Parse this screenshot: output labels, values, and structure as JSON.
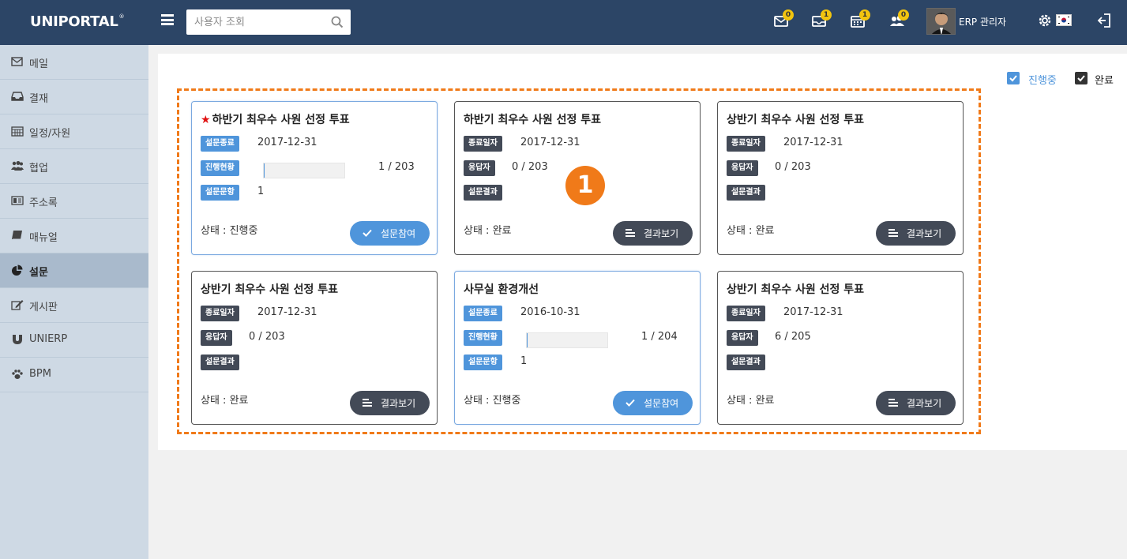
{
  "app": {
    "logo": "UNIPORTAL",
    "logo_mark": "®"
  },
  "search": {
    "placeholder": "사용자 조회"
  },
  "header": {
    "badges": {
      "mail": "0",
      "approval": "1",
      "schedule": "1",
      "collab": "0"
    },
    "user_name": "ERP 관리자"
  },
  "sidebar": {
    "items": [
      {
        "label": "메일",
        "icon": "mail-icon"
      },
      {
        "label": "결재",
        "icon": "inbox-icon"
      },
      {
        "label": "일정/자원",
        "icon": "calendar-icon"
      },
      {
        "label": "협업",
        "icon": "users-icon"
      },
      {
        "label": "주소록",
        "icon": "address-card-icon"
      },
      {
        "label": "매뉴얼",
        "icon": "book-icon"
      },
      {
        "label": "설문",
        "icon": "pie-chart-icon",
        "active": true
      },
      {
        "label": "게시판",
        "icon": "edit-icon"
      },
      {
        "label": "UNIERP",
        "icon": "magnet-icon"
      },
      {
        "label": "BPM",
        "icon": "paw-icon"
      }
    ]
  },
  "filters": {
    "in_progress": "진행중",
    "done": "완료"
  },
  "marker": "1",
  "cards": [
    {
      "title": "하반기 최우수 사원 선정 투표",
      "starred": true,
      "state": "progress",
      "rows": [
        {
          "tag": "설문종료",
          "value": "2017-12-31"
        },
        {
          "tag": "진행현황",
          "value": "1 / 203",
          "progress": 0.005
        },
        {
          "tag": "설문문항",
          "value": "1"
        }
      ],
      "status": "상태 : 진행중",
      "button": "설문참여"
    },
    {
      "title": "하반기 최우수 사원 선정 투표",
      "starred": false,
      "state": "done",
      "rows": [
        {
          "tag": "종료일자",
          "value": "2017-12-31"
        },
        {
          "tag": "응답자",
          "value": "0 / 203"
        },
        {
          "tag": "설문결과",
          "value": ""
        }
      ],
      "status": "상태 : 완료",
      "button": "결과보기"
    },
    {
      "title": "상반기 최우수 사원 선정 투표",
      "starred": false,
      "state": "done",
      "rows": [
        {
          "tag": "종료일자",
          "value": "2017-12-31"
        },
        {
          "tag": "응답자",
          "value": "0 / 203"
        },
        {
          "tag": "설문결과",
          "value": ""
        }
      ],
      "status": "상태 : 완료",
      "button": "결과보기"
    },
    {
      "title": "상반기 최우수 사원 선정 투표",
      "starred": false,
      "state": "done",
      "rows": [
        {
          "tag": "종료일자",
          "value": "2017-12-31"
        },
        {
          "tag": "응답자",
          "value": "0 / 203"
        },
        {
          "tag": "설문결과",
          "value": ""
        }
      ],
      "status": "상태 : 완료",
      "button": "결과보기"
    },
    {
      "title": "사무실 환경개선",
      "starred": false,
      "state": "progress",
      "rows": [
        {
          "tag": "설문종료",
          "value": "2016-10-31"
        },
        {
          "tag": "진행현황",
          "value": "1 / 204",
          "progress": 0.005
        },
        {
          "tag": "설문문항",
          "value": "1"
        }
      ],
      "status": "상태 : 진행중",
      "button": "설문참여"
    },
    {
      "title": "상반기 최우수 사원 선정 투표",
      "starred": false,
      "state": "done",
      "rows": [
        {
          "tag": "종료일자",
          "value": "2017-12-31"
        },
        {
          "tag": "응답자",
          "value": "6 / 205"
        },
        {
          "tag": "설문결과",
          "value": ""
        }
      ],
      "status": "상태 : 완료",
      "button": "결과보기"
    }
  ]
}
